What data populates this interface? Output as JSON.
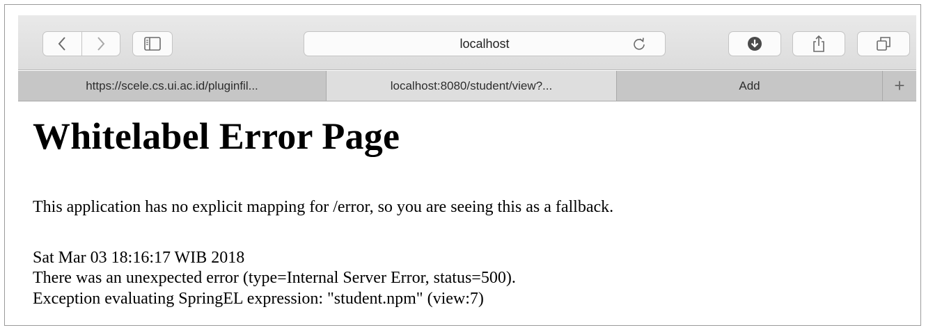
{
  "browser": {
    "url_display": "localhost",
    "icons": {
      "back": "chevron-left-icon",
      "forward": "chevron-right-icon",
      "sidebar": "sidebar-icon",
      "reload": "reload-icon",
      "downloads": "download-icon",
      "share": "share-icon",
      "tabs_overview": "tabs-icon"
    }
  },
  "tabs": [
    {
      "label": "https://scele.cs.ui.ac.id/pluginfil...",
      "active": false
    },
    {
      "label": "localhost:8080/student/view?...",
      "active": true
    },
    {
      "label": "Add",
      "active": false
    }
  ],
  "new_tab_symbol": "+",
  "page": {
    "title": "Whitelabel Error Page",
    "message": "This application has no explicit mapping for /error, so you are seeing this as a fallback.",
    "timestamp": "Sat Mar 03 18:16:17 WIB 2018",
    "error_line": "There was an unexpected error (type=Internal Server Error, status=500).",
    "exception_line": "Exception evaluating SpringEL expression: \"student.npm\" (view:7)"
  }
}
